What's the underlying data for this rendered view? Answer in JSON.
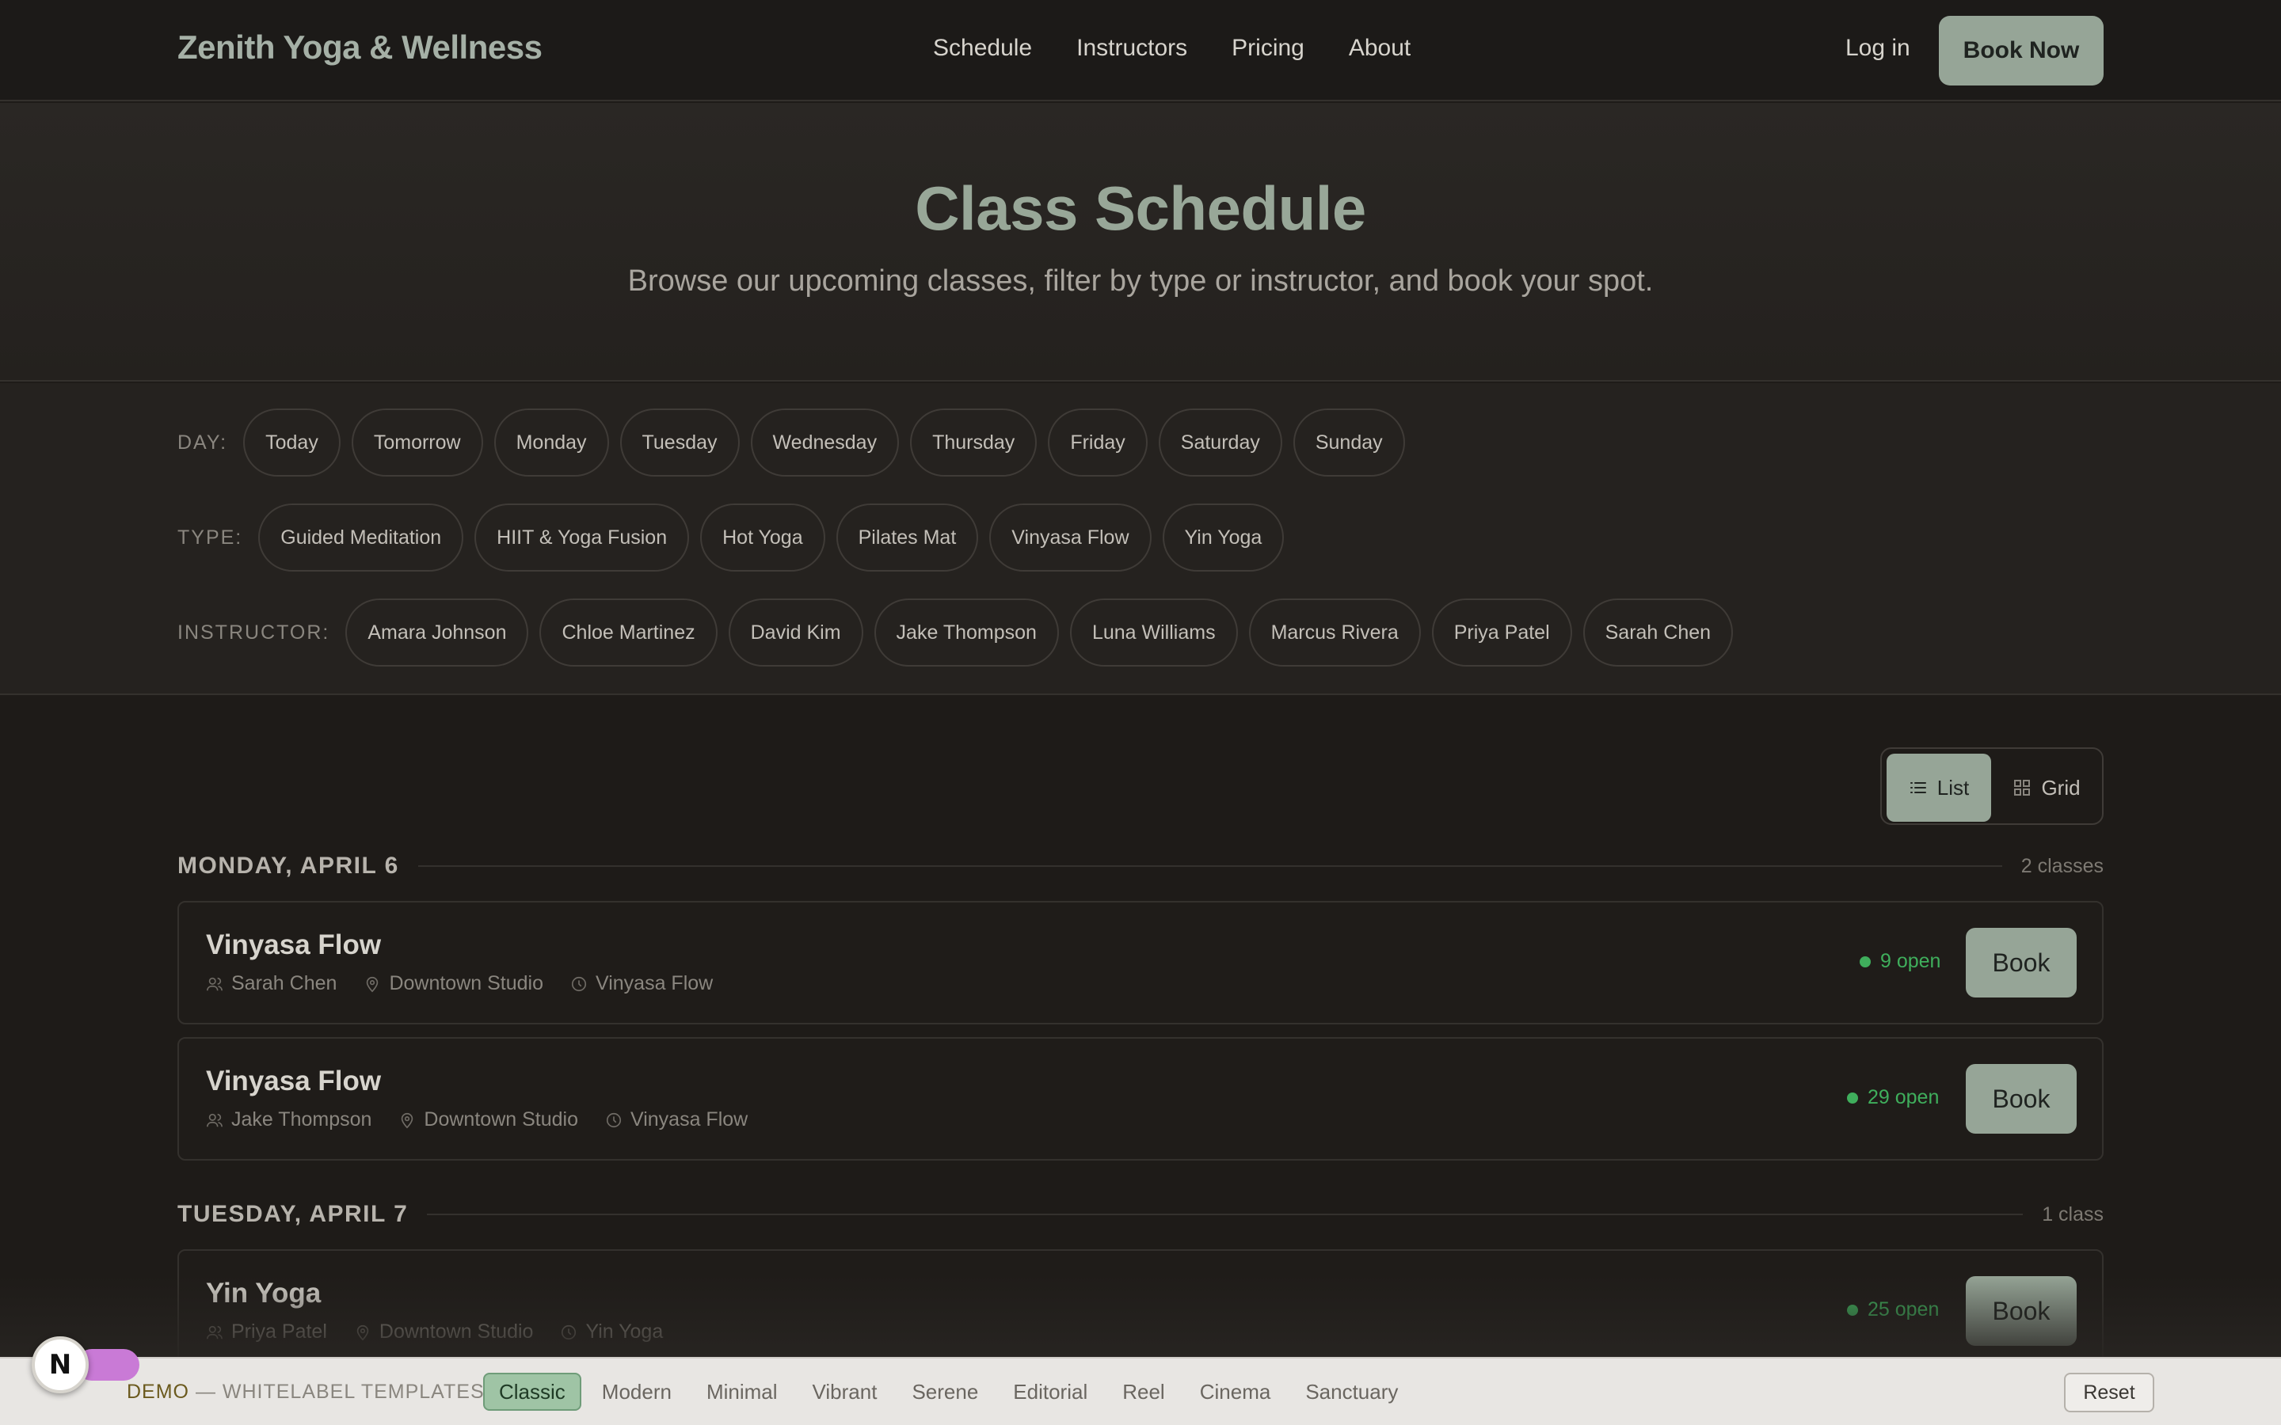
{
  "navbar": {
    "brand": "Zenith Yoga & Wellness",
    "links": [
      "Schedule",
      "Instructors",
      "Pricing",
      "About"
    ],
    "login": "Log in",
    "book_now": "Book Now"
  },
  "hero": {
    "title": "Class Schedule",
    "subtitle": "Browse our upcoming classes, filter by type or instructor, and book your spot."
  },
  "filters": {
    "day": {
      "label": "DAY:",
      "options": [
        "Today",
        "Tomorrow",
        "Monday",
        "Tuesday",
        "Wednesday",
        "Thursday",
        "Friday",
        "Saturday",
        "Sunday"
      ]
    },
    "type": {
      "label": "TYPE:",
      "options": [
        "Guided Meditation",
        "HIIT & Yoga Fusion",
        "Hot Yoga",
        "Pilates Mat",
        "Vinyasa Flow",
        "Yin Yoga"
      ]
    },
    "instructor": {
      "label": "INSTRUCTOR:",
      "options": [
        "Amara Johnson",
        "Chloe Martinez",
        "David Kim",
        "Jake Thompson",
        "Luna Williams",
        "Marcus Rivera",
        "Priya Patel",
        "Sarah Chen"
      ]
    }
  },
  "view_toggle": {
    "list": "List",
    "grid": "Grid",
    "active": "list"
  },
  "schedule": [
    {
      "day": "MONDAY, APRIL 6",
      "count": "2 classes",
      "classes": [
        {
          "name": "Vinyasa Flow",
          "instructor": "Sarah Chen",
          "location": "Downtown Studio",
          "type": "Vinyasa Flow",
          "spots": "9 open",
          "book": "Book"
        },
        {
          "name": "Vinyasa Flow",
          "instructor": "Jake Thompson",
          "location": "Downtown Studio",
          "type": "Vinyasa Flow",
          "spots": "29 open",
          "book": "Book"
        }
      ]
    },
    {
      "day": "TUESDAY, APRIL 7",
      "count": "1 class",
      "classes": [
        {
          "name": "Yin Yoga",
          "instructor": "Priya Patel",
          "location": "Downtown Studio",
          "type": "Yin Yoga",
          "spots": "25 open",
          "book": "Book"
        }
      ]
    }
  ],
  "demo_bar": {
    "demo": "DEMO",
    "label": " — WHITELABEL TEMPLATES",
    "themes": [
      "Classic",
      "Modern",
      "Minimal",
      "Vibrant",
      "Serene",
      "Editorial",
      "Reel",
      "Cinema",
      "Sanctuary"
    ],
    "active_theme": "Classic",
    "reset": "Reset"
  },
  "badge": {
    "letter": "N"
  },
  "colors": {
    "accent": "#96a597",
    "background": "#1e1b18",
    "open_spots": "#3fae5c",
    "active_theme": "#9fc4a5"
  }
}
